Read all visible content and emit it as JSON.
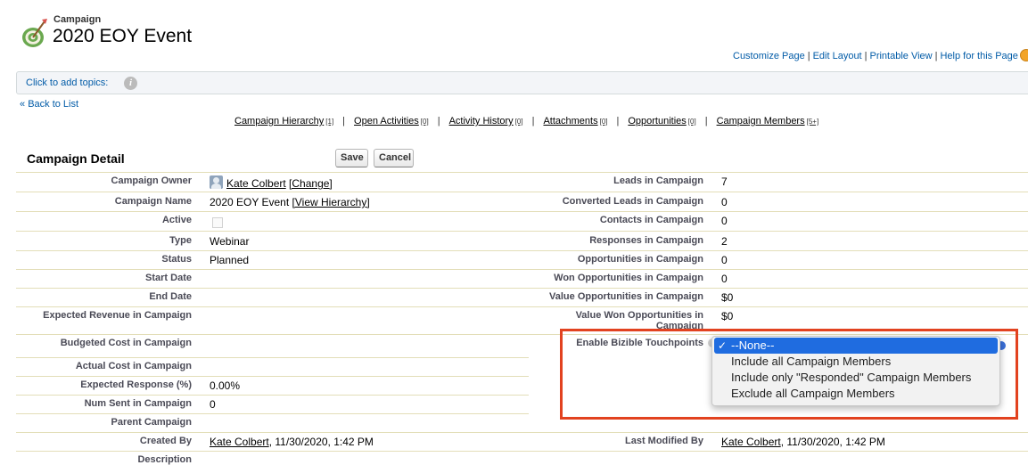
{
  "header": {
    "object_type": "Campaign",
    "record_name": "2020 EOY Event",
    "links": [
      "Customize Page",
      "Edit Layout",
      "Printable View",
      "Help for this Page"
    ]
  },
  "topics": {
    "label": "Click to add topics:"
  },
  "back_link": {
    "prefix": "«",
    "label": "Back to List"
  },
  "related_links": [
    {
      "label": "Campaign Hierarchy",
      "count": "[1]"
    },
    {
      "label": "Open Activities",
      "count": "[0]"
    },
    {
      "label": "Activity History",
      "count": "[0]"
    },
    {
      "label": "Attachments",
      "count": "[0]"
    },
    {
      "label": "Opportunities",
      "count": "[0]"
    },
    {
      "label": "Campaign Members",
      "count": "[5+]"
    }
  ],
  "detail": {
    "title": "Campaign Detail",
    "save_label": "Save",
    "cancel_label": "Cancel",
    "left": {
      "owner_label": "Campaign Owner",
      "owner_name": "Kate Colbert",
      "owner_change": "[Change]",
      "name_label": "Campaign Name",
      "name_value": "2020 EOY Event",
      "name_link": "[View Hierarchy]",
      "active_label": "Active",
      "type_label": "Type",
      "type_value": "Webinar",
      "status_label": "Status",
      "status_value": "Planned",
      "start_label": "Start Date",
      "end_label": "End Date",
      "exp_rev_label": "Expected Revenue in Campaign",
      "budget_label": "Budgeted Cost in Campaign",
      "actual_label": "Actual Cost in Campaign",
      "exp_resp_label": "Expected Response (%)",
      "exp_resp_value": "0.00%",
      "num_sent_label": "Num Sent in Campaign",
      "num_sent_value": "0",
      "parent_label": "Parent Campaign",
      "created_label": "Created By",
      "created_name": "Kate Colbert",
      "created_date": ", 11/30/2020, 1:42 PM",
      "desc_label": "Description"
    },
    "right": {
      "leads_label": "Leads in Campaign",
      "leads_value": "7",
      "conv_label": "Converted Leads in Campaign",
      "conv_value": "0",
      "contacts_label": "Contacts in Campaign",
      "contacts_value": "0",
      "responses_label": "Responses in Campaign",
      "responses_value": "2",
      "opps_label": "Opportunities in Campaign",
      "opps_value": "0",
      "won_label": "Won Opportunities in Campaign",
      "won_value": "0",
      "value_opps_label": "Value Opportunities in Campaign",
      "value_opps_value": "$0",
      "value_won_label": "Value Won Opportunities in Campaign",
      "value_won_value": "$0",
      "bizible_label": "Enable Bizible Touchpoints",
      "modified_label": "Last Modified By",
      "modified_name": "Kate Colbert",
      "modified_date": ", 11/30/2020, 1:42 PM"
    }
  },
  "dropdown": {
    "checkmark": "✓",
    "options": [
      "--None--",
      "Include all Campaign Members",
      "Include only \"Responded\" Campaign Members",
      "Exclude all Campaign Members"
    ],
    "selected_index": 0
  },
  "colors": {
    "link_blue": "#015ba7",
    "highlight_red": "#e2421f",
    "selected_option": "#1f6ce0"
  }
}
